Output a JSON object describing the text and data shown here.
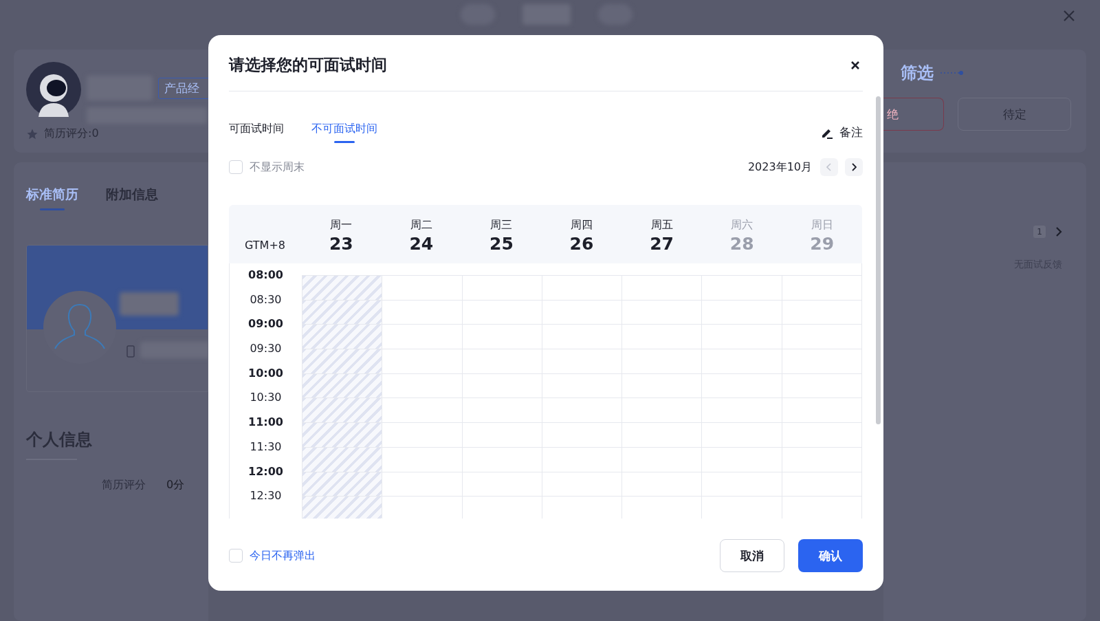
{
  "background": {
    "profile": {
      "tag": "产品经",
      "score": "简历评分:0"
    },
    "tabs": [
      {
        "label": "标准简历",
        "selected": true
      },
      {
        "label": "附加信息",
        "selected": false
      }
    ],
    "section_title": "个人信息",
    "fields": [
      {
        "label": "简历评分",
        "value": "0分"
      }
    ],
    "right": {
      "title": "筛选",
      "reject_button": "绝",
      "pending_button": "待定",
      "page": "1",
      "feedback": "无面试反馈"
    }
  },
  "dialog": {
    "title": "请选择您的可面试时间",
    "tabs": [
      {
        "label": "可面试时间",
        "selected": false
      },
      {
        "label": "不可面试时间",
        "selected": true
      }
    ],
    "note_button": "备注",
    "hide_weekend": {
      "label": "不显示周末",
      "checked": false
    },
    "month": "2023年10月",
    "prev_disabled": true,
    "timezone": "GTM+8",
    "days": [
      {
        "weekday": "周一",
        "date": "23",
        "weekend": false,
        "unavailable": true
      },
      {
        "weekday": "周二",
        "date": "24",
        "weekend": false,
        "unavailable": false
      },
      {
        "weekday": "周三",
        "date": "25",
        "weekend": false,
        "unavailable": false
      },
      {
        "weekday": "周四",
        "date": "26",
        "weekend": false,
        "unavailable": false
      },
      {
        "weekday": "周五",
        "date": "27",
        "weekend": false,
        "unavailable": false
      },
      {
        "weekday": "周六",
        "date": "28",
        "weekend": true,
        "unavailable": false
      },
      {
        "weekday": "周日",
        "date": "29",
        "weekend": true,
        "unavailable": false
      }
    ],
    "times": [
      {
        "label": "08:00",
        "kind": "hour"
      },
      {
        "label": "08:30",
        "kind": "half"
      },
      {
        "label": "09:00",
        "kind": "hour"
      },
      {
        "label": "09:30",
        "kind": "half"
      },
      {
        "label": "10:00",
        "kind": "hour"
      },
      {
        "label": "10:30",
        "kind": "half"
      },
      {
        "label": "11:00",
        "kind": "hour"
      },
      {
        "label": "11:30",
        "kind": "half"
      },
      {
        "label": "12:00",
        "kind": "hour"
      },
      {
        "label": "12:30",
        "kind": "half"
      }
    ],
    "dont_show_today": {
      "label": "今日不再弹出",
      "checked": false
    },
    "cancel_button": "取消",
    "confirm_button": "确认"
  }
}
